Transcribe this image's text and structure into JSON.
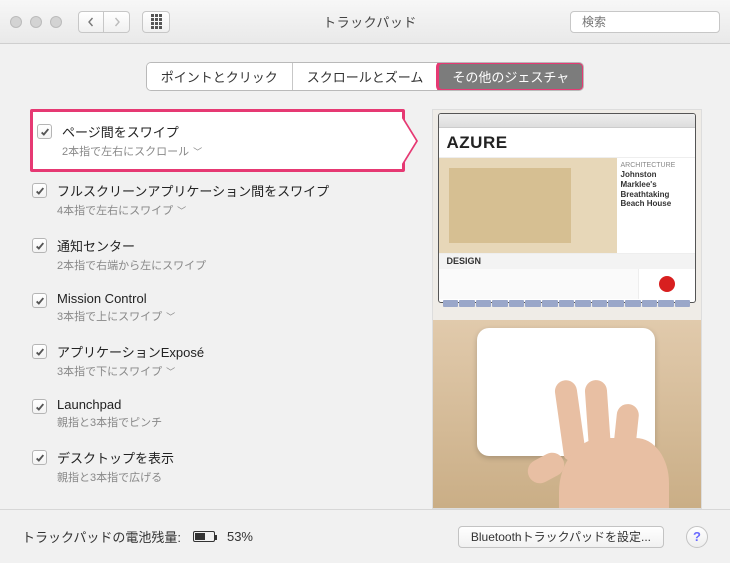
{
  "window": {
    "title": "トラックパッド"
  },
  "search": {
    "placeholder": "検索"
  },
  "tabs": {
    "t0": "ポイントとクリック",
    "t1": "スクロールとズーム",
    "t2": "その他のジェスチャ"
  },
  "options": [
    {
      "title": "ページ間をスワイプ",
      "sub": "2本指で左右にスクロール",
      "dropdown": true
    },
    {
      "title": "フルスクリーンアプリケーション間をスワイプ",
      "sub": "4本指で左右にスワイプ",
      "dropdown": true
    },
    {
      "title": "通知センター",
      "sub": "2本指で右端から左にスワイプ",
      "dropdown": false
    },
    {
      "title": "Mission Control",
      "sub": "3本指で上にスワイプ",
      "dropdown": true
    },
    {
      "title": "アプリケーションExposé",
      "sub": "3本指で下にスワイプ",
      "dropdown": true
    },
    {
      "title": "Launchpad",
      "sub": "親指と3本指でピンチ",
      "dropdown": false
    },
    {
      "title": "デスクトップを表示",
      "sub": "親指と3本指で広げる",
      "dropdown": false
    }
  ],
  "preview": {
    "logo": "AZURE",
    "sidebar_kicker": "ARCHITECTURE",
    "sidebar_headline": "Johnston Marklee's Breathtaking Beach House",
    "strip": "DESIGN"
  },
  "footer": {
    "battery_label": "トラックパッドの電池残量:",
    "battery_pct": "53%",
    "bt_button": "Bluetoothトラックパッドを設定...",
    "help": "?"
  }
}
